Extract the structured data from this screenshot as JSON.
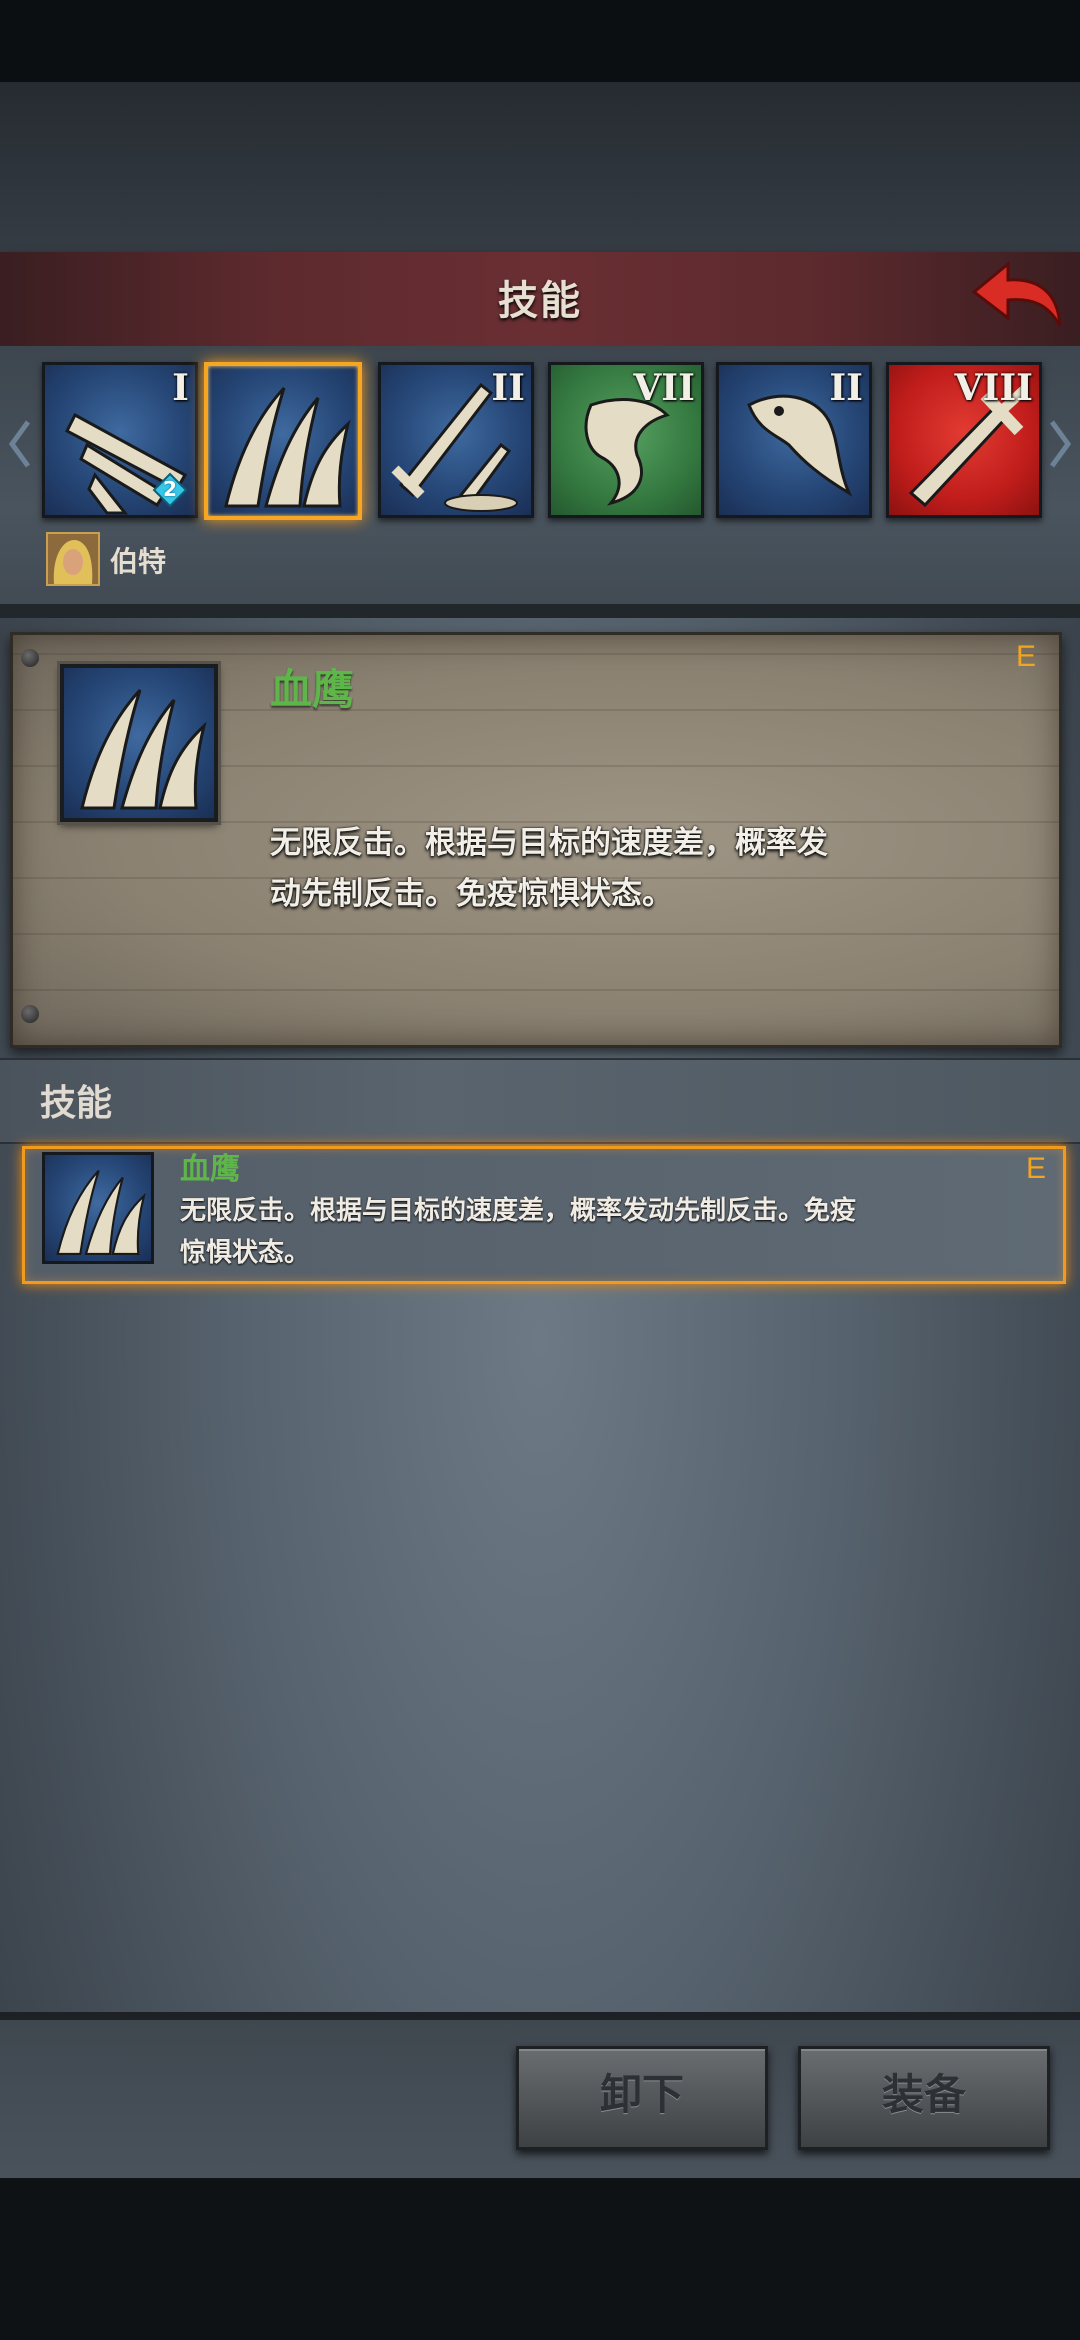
{
  "header": {
    "title": "技能"
  },
  "skill_slots": [
    {
      "numeral": "I",
      "color": "blue",
      "gem_count": "2",
      "selected": false
    },
    {
      "numeral": "",
      "color": "blue",
      "selected": true
    },
    {
      "numeral": "II",
      "color": "blue",
      "selected": false
    },
    {
      "numeral": "VII",
      "color": "green",
      "selected": false
    },
    {
      "numeral": "II",
      "color": "blue",
      "selected": false
    },
    {
      "numeral": "VIII",
      "color": "red",
      "selected": false
    }
  ],
  "hero": {
    "name": "伯特"
  },
  "detail": {
    "name": "血鹰",
    "grade": "E",
    "description_line1": "无限反击。根据与目标的速度差，概率发",
    "description_line2": "动先制反击。免疫惊惧状态。"
  },
  "section": {
    "title": "技能"
  },
  "list": [
    {
      "name": "血鹰",
      "grade": "E",
      "description_line1": "无限反击。根据与目标的速度差，概率发动先制反击。免疫",
      "description_line2": "惊惧状态。"
    }
  ],
  "actions": {
    "unequip_label": "卸下",
    "equip_label": "装备"
  },
  "colors": {
    "accent_orange": "#f29a1e",
    "skill_name_green": "#5eb549",
    "title_red": "#6a2f33"
  }
}
